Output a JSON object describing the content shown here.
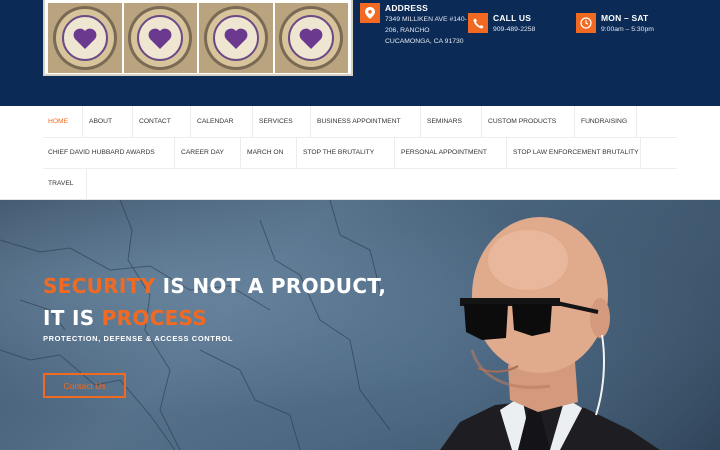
{
  "header": {
    "logo_badges": [
      "badge-1",
      "badge-2",
      "badge-3",
      "badge-4"
    ],
    "address": {
      "title": "ADDRESS",
      "line1": "7349 MILLIKEN AVE #140-",
      "line2": "206, RANCHO",
      "line3": "CUCAMONGA, CA 91730",
      "icon": "map-pin-icon"
    },
    "call": {
      "title": "CALL US",
      "phone": "909-489-2258",
      "icon": "phone-icon"
    },
    "hours": {
      "title": "MON – SAT",
      "time": "9:00am – 5:30pm",
      "icon": "clock-icon"
    }
  },
  "nav": {
    "row1": [
      "HOME",
      "ABOUT",
      "CONTACT",
      "CALENDAR",
      "SERVICES",
      "BUSINESS APPOINTMENT",
      "SEMINARS",
      "CUSTOM PRODUCTS",
      "FUNDRAISING"
    ],
    "row2": [
      "CHIEF DAVID HUBBARD AWARDS",
      "CAREER DAY",
      "MARCH ON",
      "STOP THE BRUTALITY",
      "PERSONAL APPOINTMENT",
      "STOP LAW ENFORCEMENT BRUTALITY"
    ],
    "row3": [
      "TRAVEL"
    ],
    "active": "HOME"
  },
  "hero": {
    "line1_accent": "SECURITY",
    "line1_rest": " IS NOT A PRODUCT,",
    "line2_start": "IT IS ",
    "line2_accent": "PROCESS",
    "tagline": "PROTECTION, DEFENSE & ACCESS CONTROL",
    "cta_label": "Contact Us"
  },
  "colors": {
    "header_bg": "#0b2a55",
    "accent": "#f26a21",
    "nav_text": "#333333"
  }
}
